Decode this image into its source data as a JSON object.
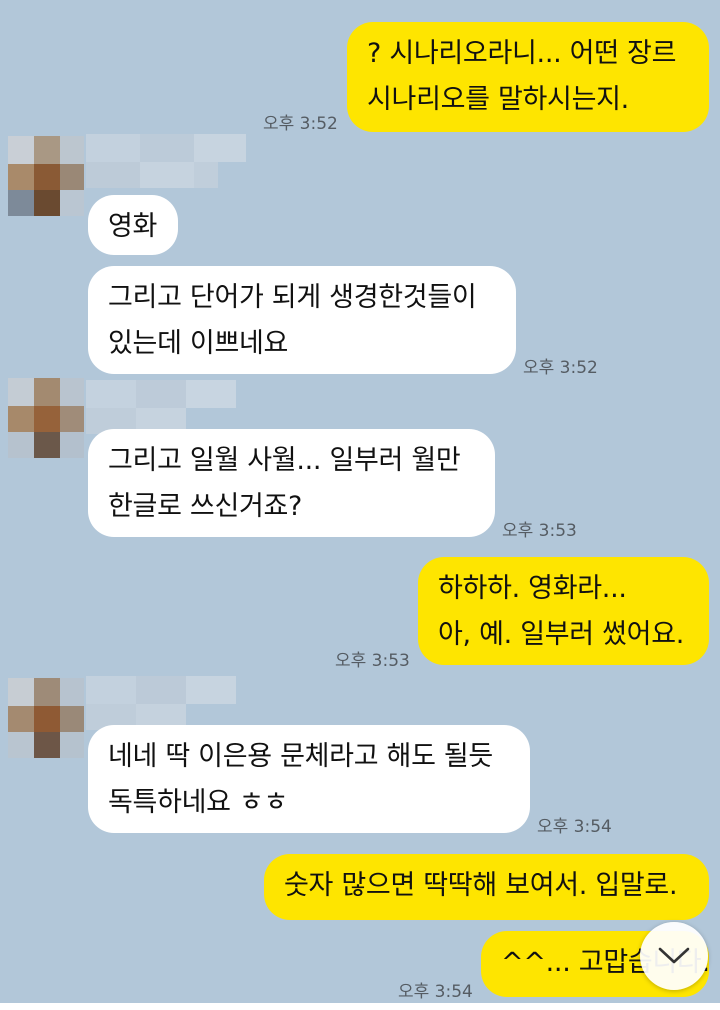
{
  "messages": [
    {
      "id": "m1",
      "sender": "me",
      "lines": "? 시나리오라니... 어떤 장르\n시나리오를 말하시는지.",
      "time": "오후 3:52"
    },
    {
      "id": "m2",
      "sender": "other",
      "lines": "영화"
    },
    {
      "id": "m3",
      "sender": "other",
      "lines": "그리고 단어가 되게 생경한것들이\n있는데 이쁘네요",
      "time": "오후 3:52"
    },
    {
      "id": "m4",
      "sender": "other",
      "lines": "그리고 일월 사월... 일부러 월만\n한글로 쓰신거죠?",
      "time": "오후 3:53"
    },
    {
      "id": "m5",
      "sender": "me",
      "lines": "하하하. 영화라...\n아, 예. 일부러 썼어요.",
      "time": "오후 3:53"
    },
    {
      "id": "m6",
      "sender": "other",
      "lines": "네네 딱 이은용 문체라고 해도 될듯\n독특하네요 ㅎㅎ",
      "time": "오후 3:54"
    },
    {
      "id": "m7",
      "sender": "me",
      "lines": "숫자 많으면 딱딱해 보여서. 입말로."
    },
    {
      "id": "m8",
      "sender": "me",
      "lines": "^^... 고맙습니다.",
      "time": "오후 3:54"
    }
  ],
  "scroll_button": {
    "icon": "chevron-down-icon"
  },
  "colors": {
    "background": "#b2c7d9",
    "my_bubble": "#fee500",
    "their_bubble": "#ffffff"
  }
}
